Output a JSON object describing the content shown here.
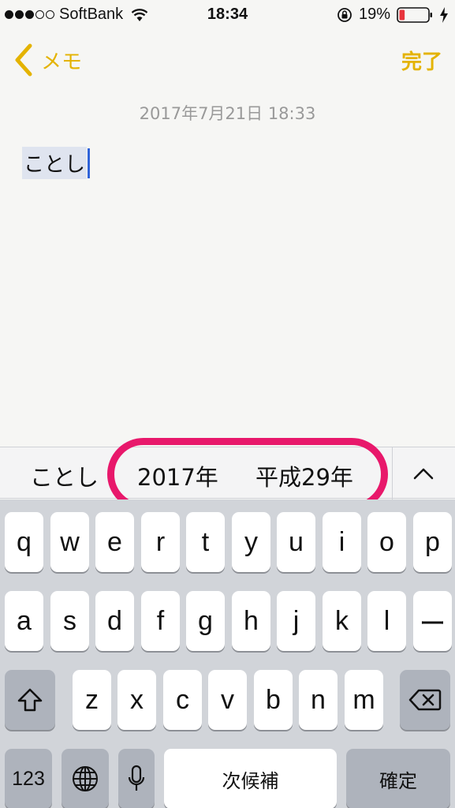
{
  "status_bar": {
    "carrier": "SoftBank",
    "time": "18:34",
    "battery_percent": "19%",
    "battery_level": 0.19,
    "battery_color": "#e8343c"
  },
  "nav": {
    "back_label": "メモ",
    "done_label": "完了",
    "accent_color": "#e4b300"
  },
  "note": {
    "date": "2017年7月21日 18:33",
    "text": "ことし"
  },
  "candidates": {
    "items": [
      "ことし",
      "2017年",
      "平成29年"
    ],
    "highlight_color": "#e8186b"
  },
  "keyboard": {
    "row1": [
      "q",
      "w",
      "e",
      "r",
      "t",
      "y",
      "u",
      "i",
      "o",
      "p"
    ],
    "row2": [
      "a",
      "s",
      "d",
      "f",
      "g",
      "h",
      "j",
      "k",
      "l",
      "ー"
    ],
    "row3": [
      "z",
      "x",
      "c",
      "v",
      "b",
      "n",
      "m"
    ],
    "numbers_label": "123",
    "space_label": "次候補",
    "return_label": "確定"
  },
  "icons": [
    "wifi-icon",
    "orientation-lock-icon",
    "battery-icon",
    "charging-bolt-icon",
    "chevron-left-icon",
    "chevron-up-icon",
    "shift-icon",
    "delete-icon",
    "globe-icon",
    "microphone-icon"
  ]
}
